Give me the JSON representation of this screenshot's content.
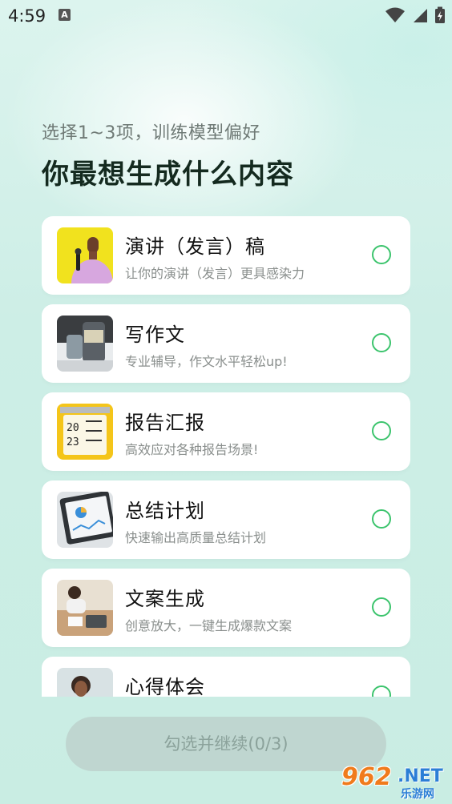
{
  "status_bar": {
    "time": "4:59",
    "notification_icon": "a-icon"
  },
  "header": {
    "subtitle": "选择1~3项，训练模型偏好",
    "title": "你最想生成什么内容"
  },
  "options": [
    {
      "title": "演讲（发言）稿",
      "desc": "让你的演讲（发言）更具感染力",
      "icon": "speaker-photo"
    },
    {
      "title": "写作文",
      "desc": "专业辅导，作文水平轻松up!",
      "icon": "jar-photo"
    },
    {
      "title": "报告汇报",
      "desc": "高效应对各种报告场景!",
      "icon": "notebook-2023-photo"
    },
    {
      "title": "总结计划",
      "desc": "快速输出高质量总结计划",
      "icon": "tablet-chart-photo"
    },
    {
      "title": "文案生成",
      "desc": "创意放大，一键生成爆款文案",
      "icon": "desk-writing-photo"
    },
    {
      "title": "心得体会",
      "desc": "",
      "icon": "portrait-photo"
    }
  ],
  "footer": {
    "continue_label": "勾选并继续(0/3)"
  },
  "watermark": {
    "num": "962",
    "net": ".NET",
    "cn": "乐游网"
  },
  "colors": {
    "accent_green": "#3cc46d",
    "button_bg": "#bfd6d0",
    "title_text": "#142a1f"
  }
}
